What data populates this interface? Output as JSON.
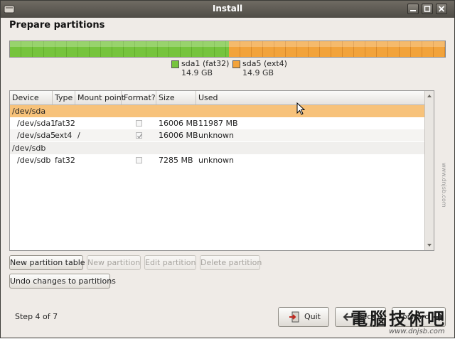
{
  "window": {
    "title": "Install"
  },
  "page": {
    "heading": "Prepare partitions"
  },
  "partition_bar": {
    "segments": [
      {
        "name": "sda1 (fat32)",
        "size": "14.9 GB",
        "color": "#76c43d",
        "fraction": 0.5
      },
      {
        "name": "sda5 (ext4)",
        "size": "14.9 GB",
        "color": "#f2a33b",
        "fraction": 0.5
      }
    ]
  },
  "table": {
    "headers": {
      "device": "Device",
      "type": "Type",
      "mount": "Mount point",
      "format": "Format?",
      "size": "Size",
      "used": "Used"
    },
    "rows": [
      {
        "device": "/dev/sda",
        "type": "",
        "mount": "",
        "format": null,
        "size": "",
        "used": ""
      },
      {
        "device": "/dev/sda1",
        "type": "fat32",
        "mount": "",
        "format": false,
        "size": "16006 MB",
        "used": "11987 MB"
      },
      {
        "device": "/dev/sda5",
        "type": "ext4",
        "mount": "/",
        "format": true,
        "size": "16006 MB",
        "used": "unknown"
      },
      {
        "device": "/dev/sdb",
        "type": "",
        "mount": "",
        "format": null,
        "size": "",
        "used": ""
      },
      {
        "device": "/dev/sdb",
        "type": "fat32",
        "mount": "",
        "format": false,
        "size": "7285 MB",
        "used": "unknown"
      }
    ]
  },
  "actions": {
    "new_table": "New partition table",
    "new_partition": "New partition",
    "edit_partition": "Edit partition",
    "delete_partition": "Delete partition",
    "undo": "Undo changes to partitions"
  },
  "footer": {
    "step": "Step 4 of 7",
    "quit": "Quit",
    "back": "Back",
    "forward": "Forward"
  },
  "watermark": {
    "text": "電腦技術吧",
    "url": "www.dnjsb.com",
    "side": "www.dnjsb.com"
  }
}
